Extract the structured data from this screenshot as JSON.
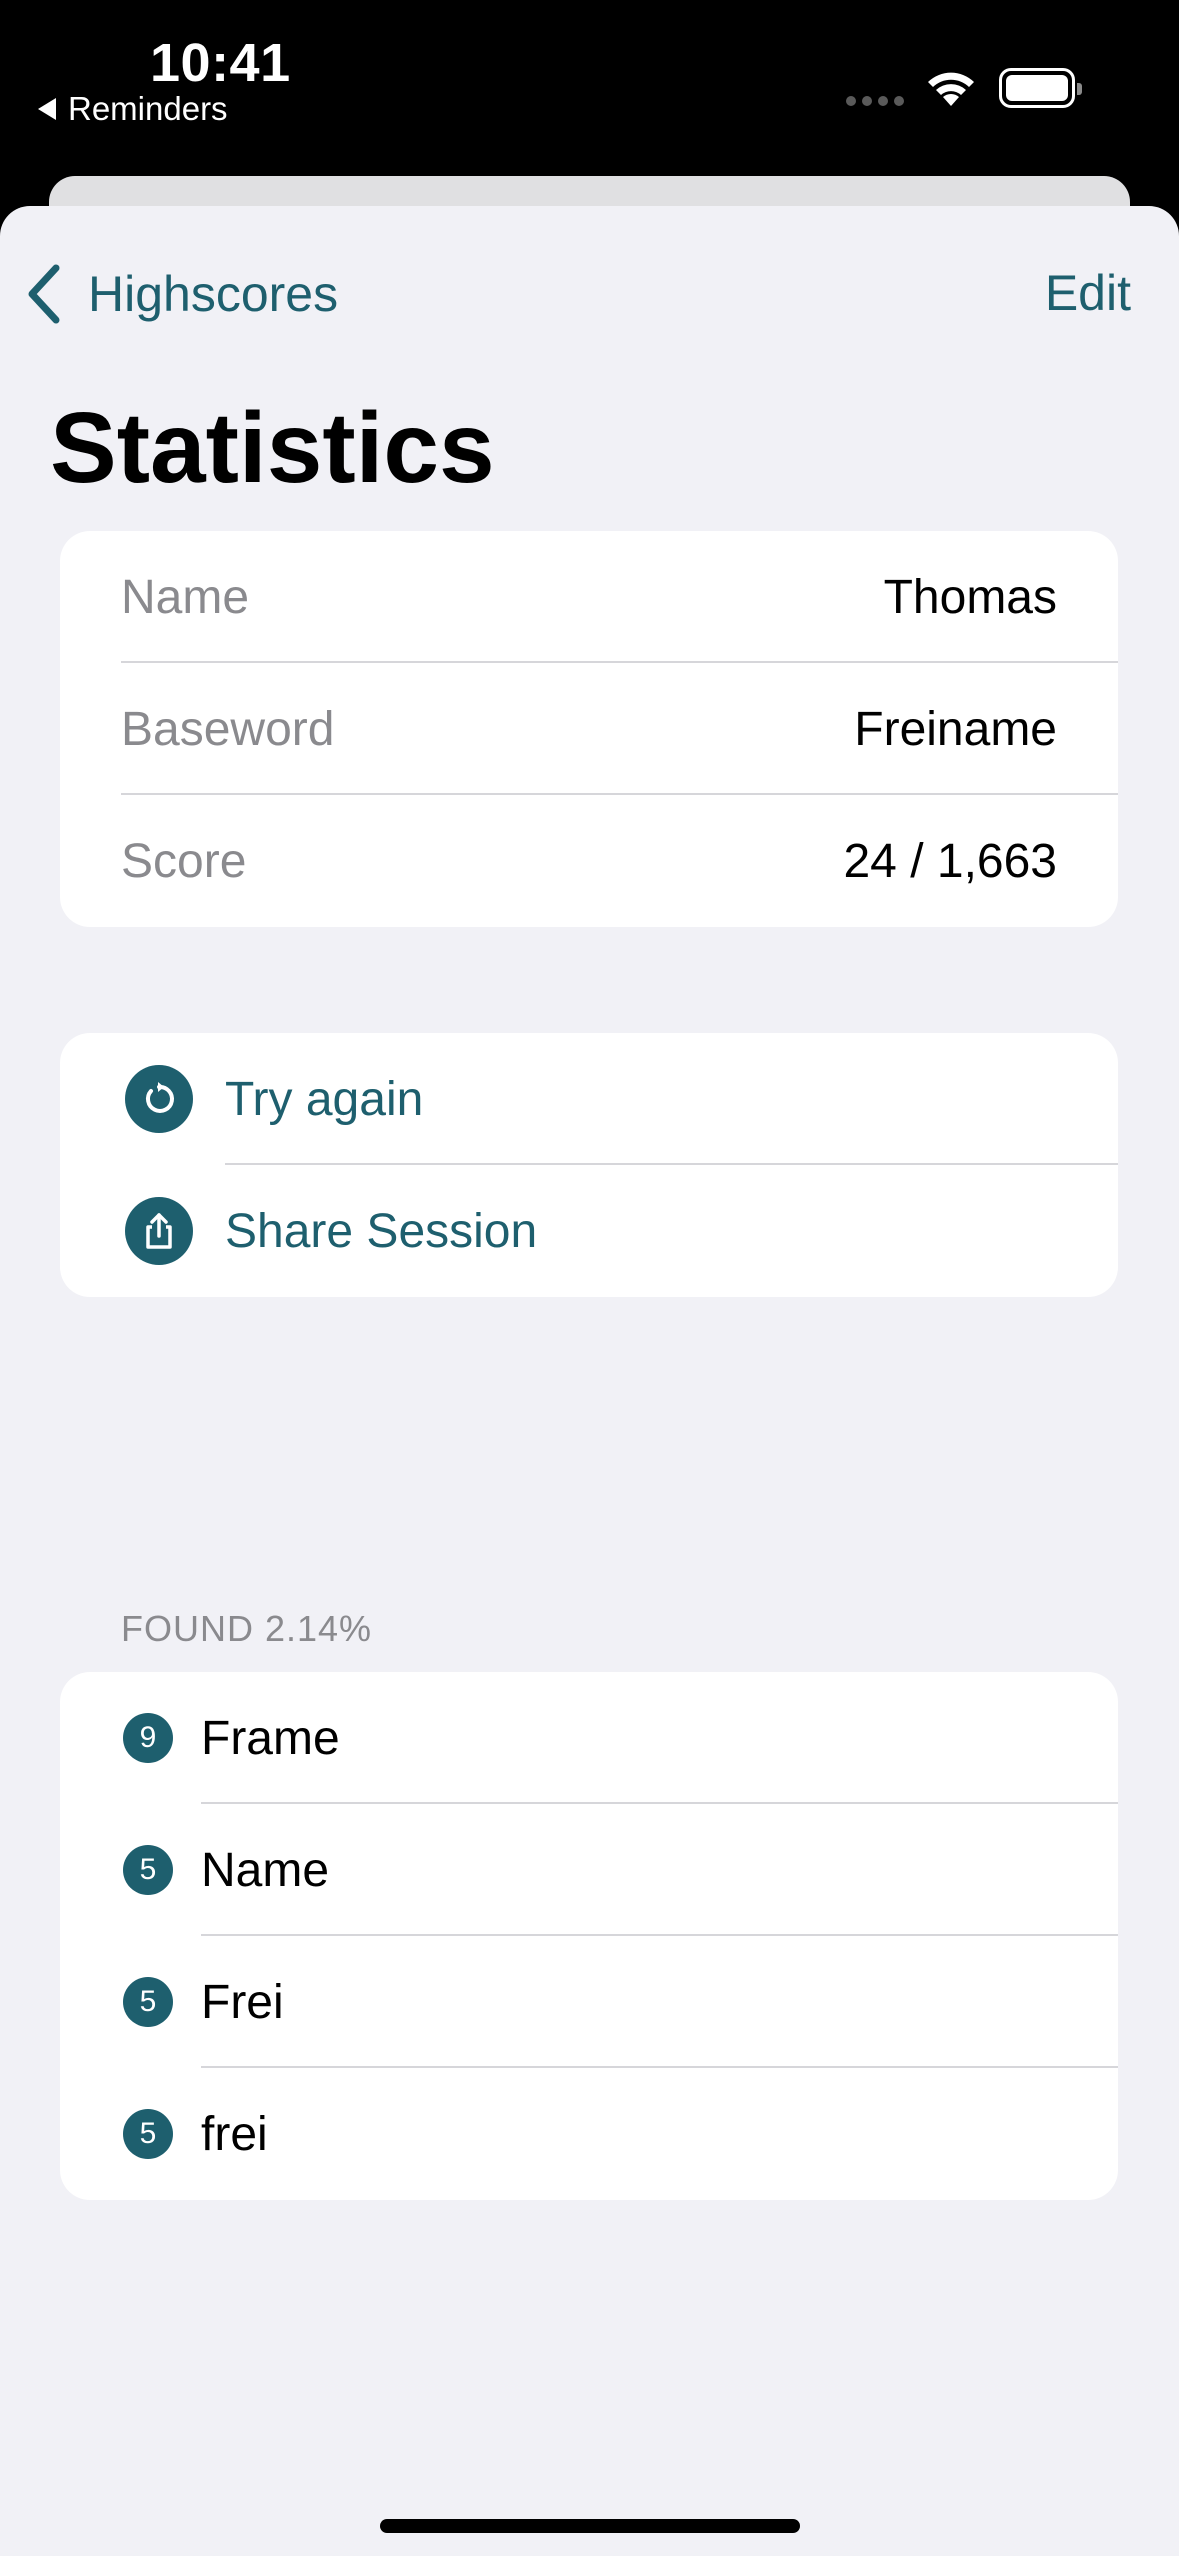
{
  "status_bar": {
    "time": "10:41",
    "back_app": "Reminders"
  },
  "nav": {
    "back_label": "Highscores",
    "edit_label": "Edit"
  },
  "page_title": "Statistics",
  "info": [
    {
      "label": "Name",
      "value": "Thomas"
    },
    {
      "label": "Baseword",
      "value": "Freiname"
    },
    {
      "label": "Score",
      "value": "24 / 1,663"
    }
  ],
  "actions": [
    {
      "label": "Try again",
      "icon": "retry-icon"
    },
    {
      "label": "Share Session",
      "icon": "share-icon"
    }
  ],
  "found_header": "FOUND 2.14%",
  "words": [
    {
      "badge": "9",
      "word": "Frame"
    },
    {
      "badge": "5",
      "word": "Name"
    },
    {
      "badge": "5",
      "word": "Frei"
    },
    {
      "badge": "5",
      "word": "frei"
    }
  ],
  "colors": {
    "accent": "#1e5f6e",
    "background": "#f1f1f6"
  }
}
